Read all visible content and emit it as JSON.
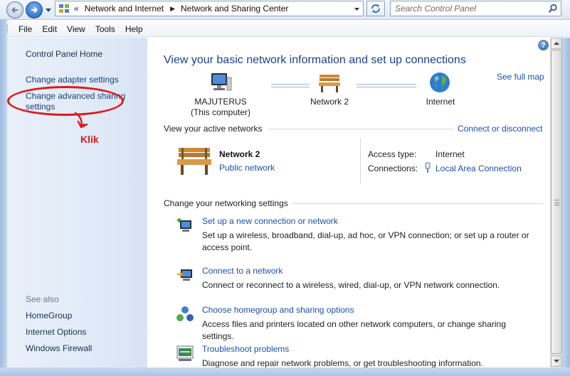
{
  "address": {
    "breadcrumbs": [
      "Network and Internet",
      "Network and Sharing Center"
    ],
    "search_placeholder": "Search Control Panel"
  },
  "menu": [
    "File",
    "Edit",
    "View",
    "Tools",
    "Help"
  ],
  "sidebar": {
    "home": "Control Panel Home",
    "adapter": "Change adapter settings",
    "advanced_line1": "Change advanced sharing",
    "advanced_line2": "settings",
    "see_also": "See also",
    "see_also_items": [
      "HomeGroup",
      "Internet Options",
      "Windows Firewall"
    ],
    "annotation": "Klik"
  },
  "main": {
    "title": "View your basic network information and set up connections",
    "full_map": "See full map",
    "map_nodes": {
      "computer_name": "MAJUTERUS",
      "computer_sub": "(This computer)",
      "network": "Network  2",
      "internet": "Internet"
    },
    "active_header": "View your active networks",
    "connect_link": "Connect or disconnect",
    "active_network": {
      "name": "Network  2",
      "type": "Public network",
      "access_label": "Access type:",
      "access_value": "Internet",
      "connections_label": "Connections:",
      "connections_value": "Local Area Connection"
    },
    "settings_header": "Change your networking settings",
    "tasks": [
      {
        "link": "Set up a new connection or network",
        "desc": "Set up a wireless, broadband, dial-up, ad hoc, or VPN connection; or set up a router or access point."
      },
      {
        "link": "Connect to a network",
        "desc": "Connect or reconnect to a wireless, wired, dial-up, or VPN network connection."
      },
      {
        "link": "Choose homegroup and sharing options",
        "desc": "Access files and printers located on other network computers, or change sharing settings."
      },
      {
        "link": "Troubleshoot problems",
        "desc": "Diagnose and repair network problems, or get troubleshooting information."
      }
    ]
  },
  "colors": {
    "link": "#1b4fb0",
    "title": "#1e3f88",
    "annotation": "#e01919",
    "sidebar_bg": "#dfe9f7"
  }
}
